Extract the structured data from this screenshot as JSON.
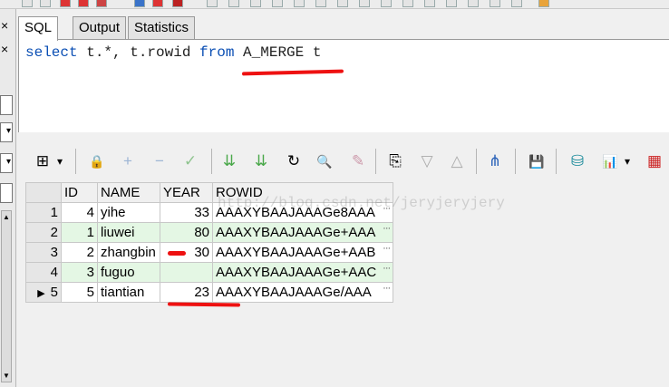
{
  "tabs": [
    {
      "label": "SQL"
    },
    {
      "label": "Output"
    },
    {
      "label": "Statistics"
    }
  ],
  "left_strip": {
    "close_glyph_1": "×",
    "close_glyph_2": "×"
  },
  "editor": {
    "sql_select": "select",
    "sql_cols": " t.*, t.rowid ",
    "sql_from": "from",
    "sql_table": "A_MERGE",
    "sql_alias": " t"
  },
  "grid": {
    "columns": [
      "ID",
      "NAME",
      "YEAR",
      "ROWID"
    ],
    "current_row_marker": "▶",
    "rows": [
      {
        "num": "1",
        "id": "4",
        "name": "yihe",
        "year": "33",
        "rowid": "AAAXYBAAJAAAGe8AAA"
      },
      {
        "num": "2",
        "id": "1",
        "name": "liuwei",
        "year": "80",
        "rowid": "AAAXYBAAJAAAGe+AAA"
      },
      {
        "num": "3",
        "id": "2",
        "name": "zhangbin",
        "year": "30",
        "rowid": "AAAXYBAAJAAAGe+AAB"
      },
      {
        "num": "4",
        "id": "3",
        "name": "fuguo",
        "year": "",
        "rowid": "AAAXYBAAJAAAGe+AAC"
      },
      {
        "num": "5",
        "id": "5",
        "name": "tiantian",
        "year": "23",
        "rowid": "AAAXYBAAJAAAGe/AAA"
      }
    ],
    "cell_button": "···"
  },
  "watermark": "http://blog.csdn.net/jeryjeryjery",
  "icons": {
    "grid_layout": "⊞",
    "dropdown": "▾",
    "lock": "🔒",
    "add": "+",
    "remove": "−",
    "post": "✓",
    "fetch_next": "⇊",
    "fetch_all": "⇊",
    "refresh": "↻",
    "find": "🔍",
    "clear": "✎",
    "query_by_example": "⎘",
    "sort_desc": "▽",
    "sort_asc": "△",
    "tree": "⋔",
    "save": "💾",
    "export_db": "⛁",
    "chart": "📊",
    "chart_menu": "▾",
    "table_view": "▦"
  },
  "colors": {
    "keyword": "#0b4fb4",
    "annotation": "#ee1111",
    "row_alt": "#e4f7e4"
  }
}
